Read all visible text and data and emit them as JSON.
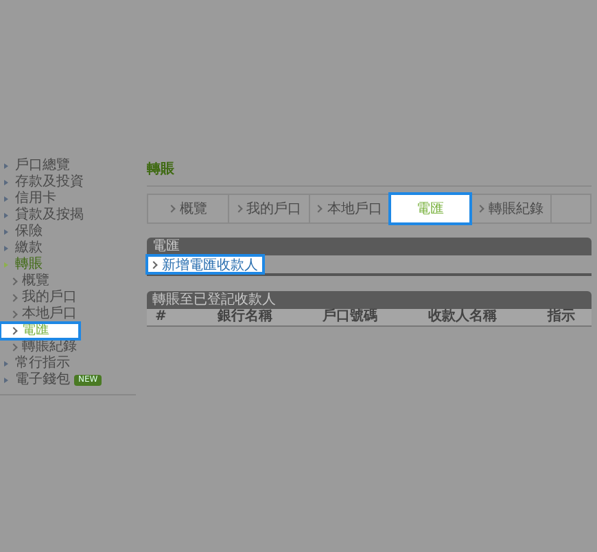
{
  "sidebar": {
    "items": [
      {
        "label": "戶口總覽",
        "selected": false
      },
      {
        "label": "存款及投資",
        "selected": false
      },
      {
        "label": "信用卡",
        "selected": false
      },
      {
        "label": "貸款及按揭",
        "selected": false
      },
      {
        "label": "保險",
        "selected": false
      },
      {
        "label": "繳款",
        "selected": false
      },
      {
        "label": "轉賬",
        "selected": true,
        "expanded": true,
        "children": [
          {
            "label": "概覽",
            "selected": false
          },
          {
            "label": "我的戶口",
            "selected": false
          },
          {
            "label": "本地戶口",
            "selected": false
          },
          {
            "label": "電匯",
            "selected": true
          },
          {
            "label": "轉賬紀錄",
            "selected": false
          }
        ]
      },
      {
        "label": "常行指示",
        "selected": false
      },
      {
        "label": "電子錢包",
        "selected": false,
        "badge": "NEW"
      }
    ]
  },
  "page_title": "轉賬",
  "tabs": [
    {
      "label": "概覽",
      "selected": false
    },
    {
      "label": "我的戶口",
      "selected": false
    },
    {
      "label": "本地戶口",
      "selected": false
    },
    {
      "label": "電匯",
      "selected": true
    },
    {
      "label": "轉賬紀錄",
      "selected": false
    }
  ],
  "section": {
    "title": "電匯",
    "link": "新增電匯收款人"
  },
  "table": {
    "title": "轉賬至已登記收款人",
    "columns": [
      "#",
      "銀行名稱",
      "戶口號碼",
      "收款人名稱",
      "指示"
    ]
  }
}
